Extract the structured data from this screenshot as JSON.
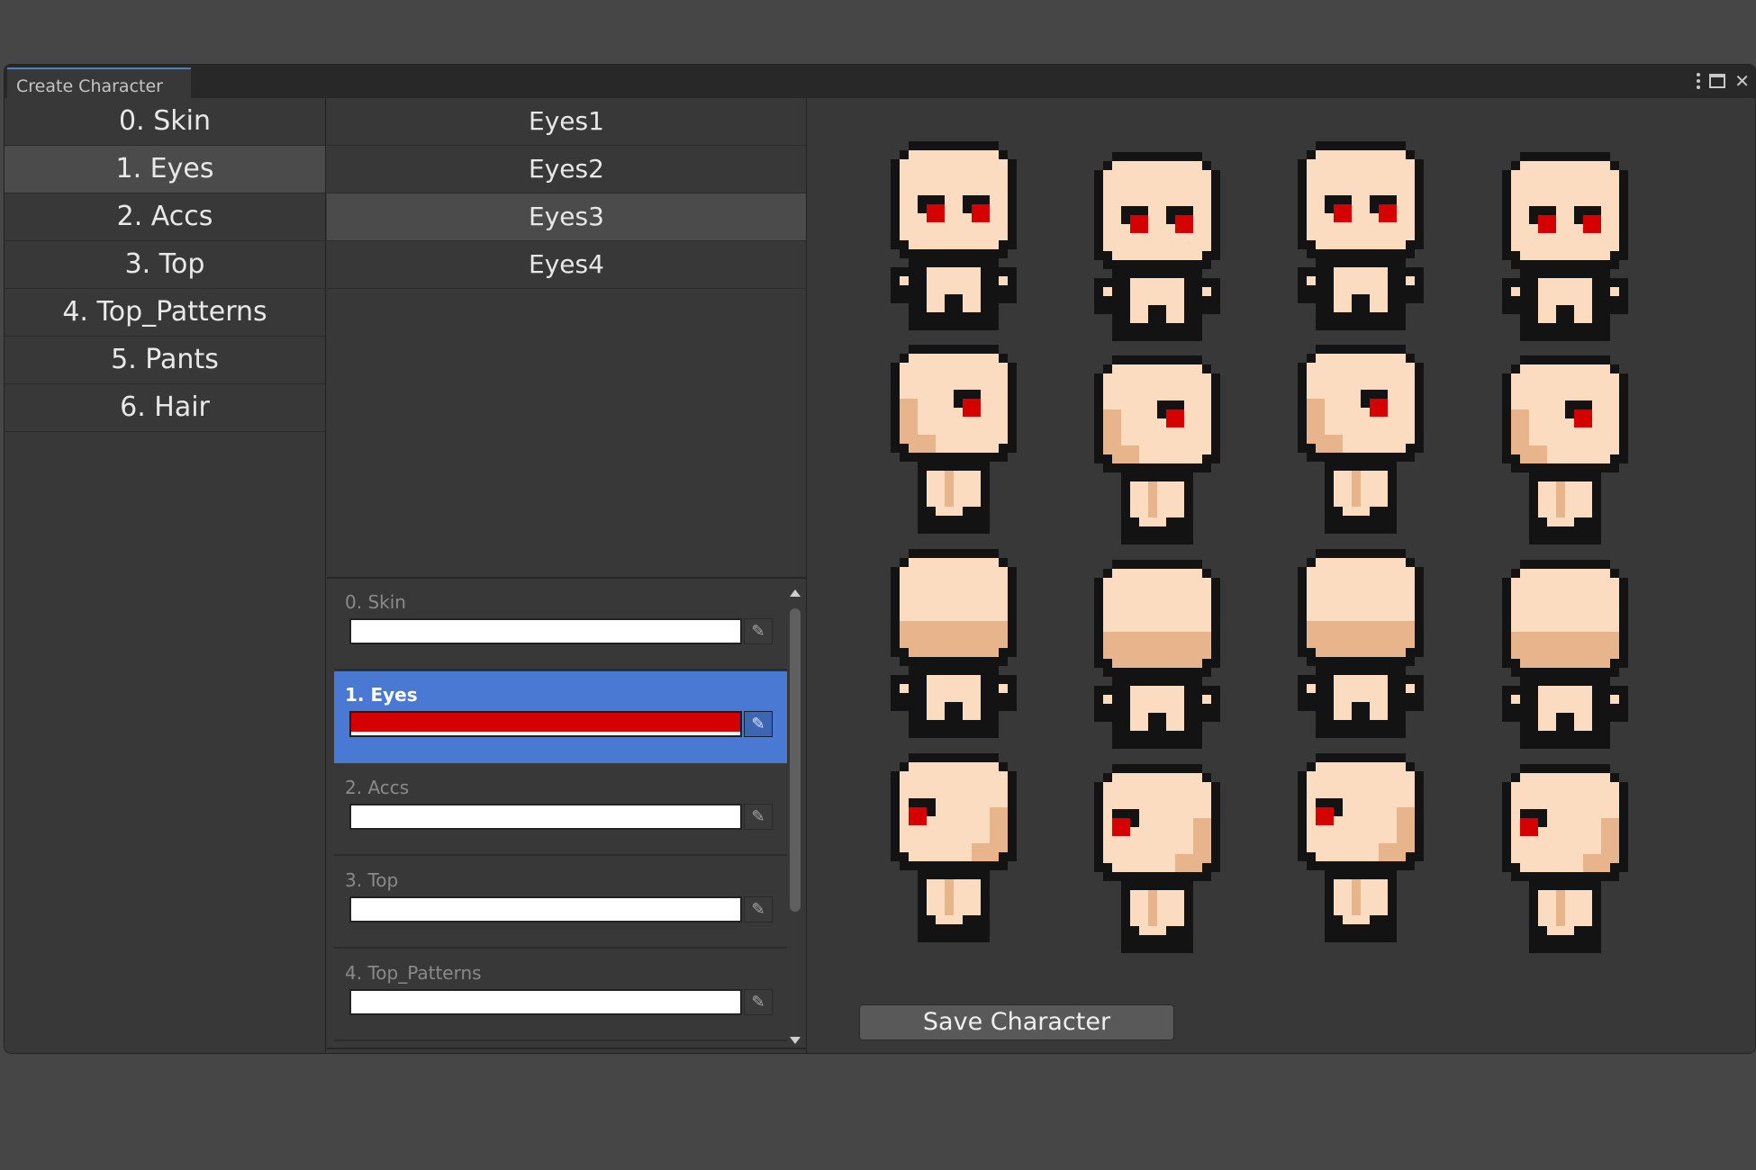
{
  "window": {
    "title": "Create Character"
  },
  "categories": [
    {
      "label": "0. Skin"
    },
    {
      "label": "1. Eyes",
      "selected": true
    },
    {
      "label": "2. Accs"
    },
    {
      "label": "3. Top"
    },
    {
      "label": "4. Top_Patterns"
    },
    {
      "label": "5. Pants"
    },
    {
      "label": "6. Hair"
    }
  ],
  "options": [
    {
      "label": "Eyes1"
    },
    {
      "label": "Eyes2"
    },
    {
      "label": "Eyes3",
      "selected": true
    },
    {
      "label": "Eyes4"
    }
  ],
  "color_layers": [
    {
      "label": "0. Skin",
      "color": "#ffffff"
    },
    {
      "label": "1. Eyes",
      "color": "#d50000",
      "selected": true
    },
    {
      "label": "2. Accs",
      "color": "#ffffff"
    },
    {
      "label": "3. Top",
      "color": "#ffffff"
    },
    {
      "label": "4. Top_Patterns",
      "color": "#ffffff"
    }
  ],
  "preview": {
    "rows": [
      {
        "direction": "down"
      },
      {
        "direction": "right"
      },
      {
        "direction": "up"
      },
      {
        "direction": "left"
      }
    ],
    "frames_per_row": 4,
    "colors": {
      "outline": "#131313",
      "skin": "#fcdcc0",
      "shade": "#e7b48b",
      "eye_red": "#d50000"
    }
  },
  "actions": {
    "save_label": "Save Character"
  },
  "icons": {
    "picker": "eyedropper-icon",
    "menu": "kebab-menu-icon",
    "maximize": "maximize-icon",
    "close": "close-icon"
  }
}
